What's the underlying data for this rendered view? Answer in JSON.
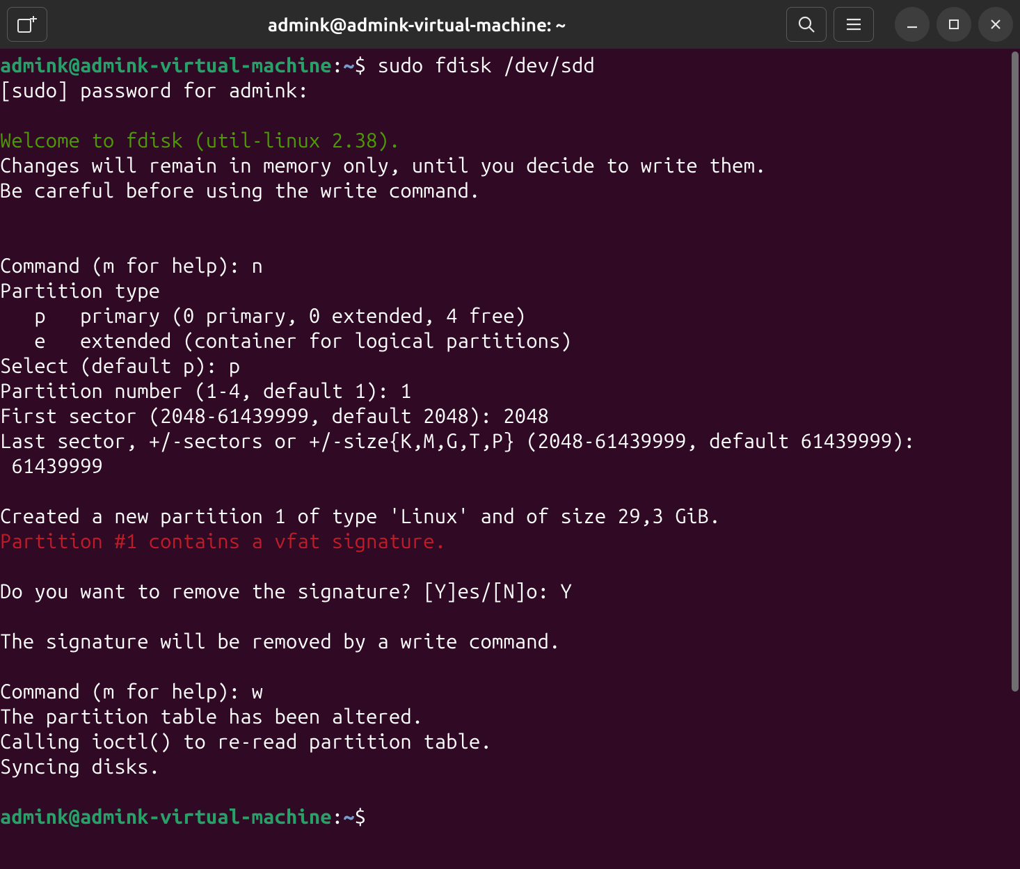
{
  "titlebar": {
    "title": "admink@admink-virtual-machine: ~"
  },
  "prompt": {
    "user_host": "admink@admink-virtual-machine",
    "colon": ":",
    "cwd": "~",
    "dollar": "$"
  },
  "session": {
    "cmd1": "sudo fdisk /dev/sdd",
    "sudo_pw": "[sudo] password for admink: ",
    "blank": "",
    "welcome": "Welcome to fdisk (util-linux 2.38).",
    "changes": "Changes will remain in memory only, until you decide to write them.",
    "careful": "Be careful before using the write command.",
    "cmd_help_n": "Command (m for help): n",
    "ptype": "Partition type",
    "p_opt": "   p   primary (0 primary, 0 extended, 4 free)",
    "e_opt": "   e   extended (container for logical partitions)",
    "select_p": "Select (default p): p",
    "pnum": "Partition number (1-4, default 1): 1",
    "first_sector": "First sector (2048-61439999, default 2048): 2048",
    "last_sector": "Last sector, +/-sectors or +/-size{K,M,G,T,P} (2048-61439999, default 61439999):",
    "last_sector_val": " 61439999",
    "created": "Created a new partition 1 of type 'Linux' and of size 29,3 GiB.",
    "vfat_sig": "Partition #1 contains a vfat signature.",
    "remove_sig": "Do you want to remove the signature? [Y]es/[N]o: Y",
    "sig_removed": "The signature will be removed by a write command.",
    "cmd_help_w": "Command (m for help): w",
    "altered": "The partition table has been altered.",
    "ioctl": "Calling ioctl() to re-read partition table.",
    "syncing": "Syncing disks."
  }
}
